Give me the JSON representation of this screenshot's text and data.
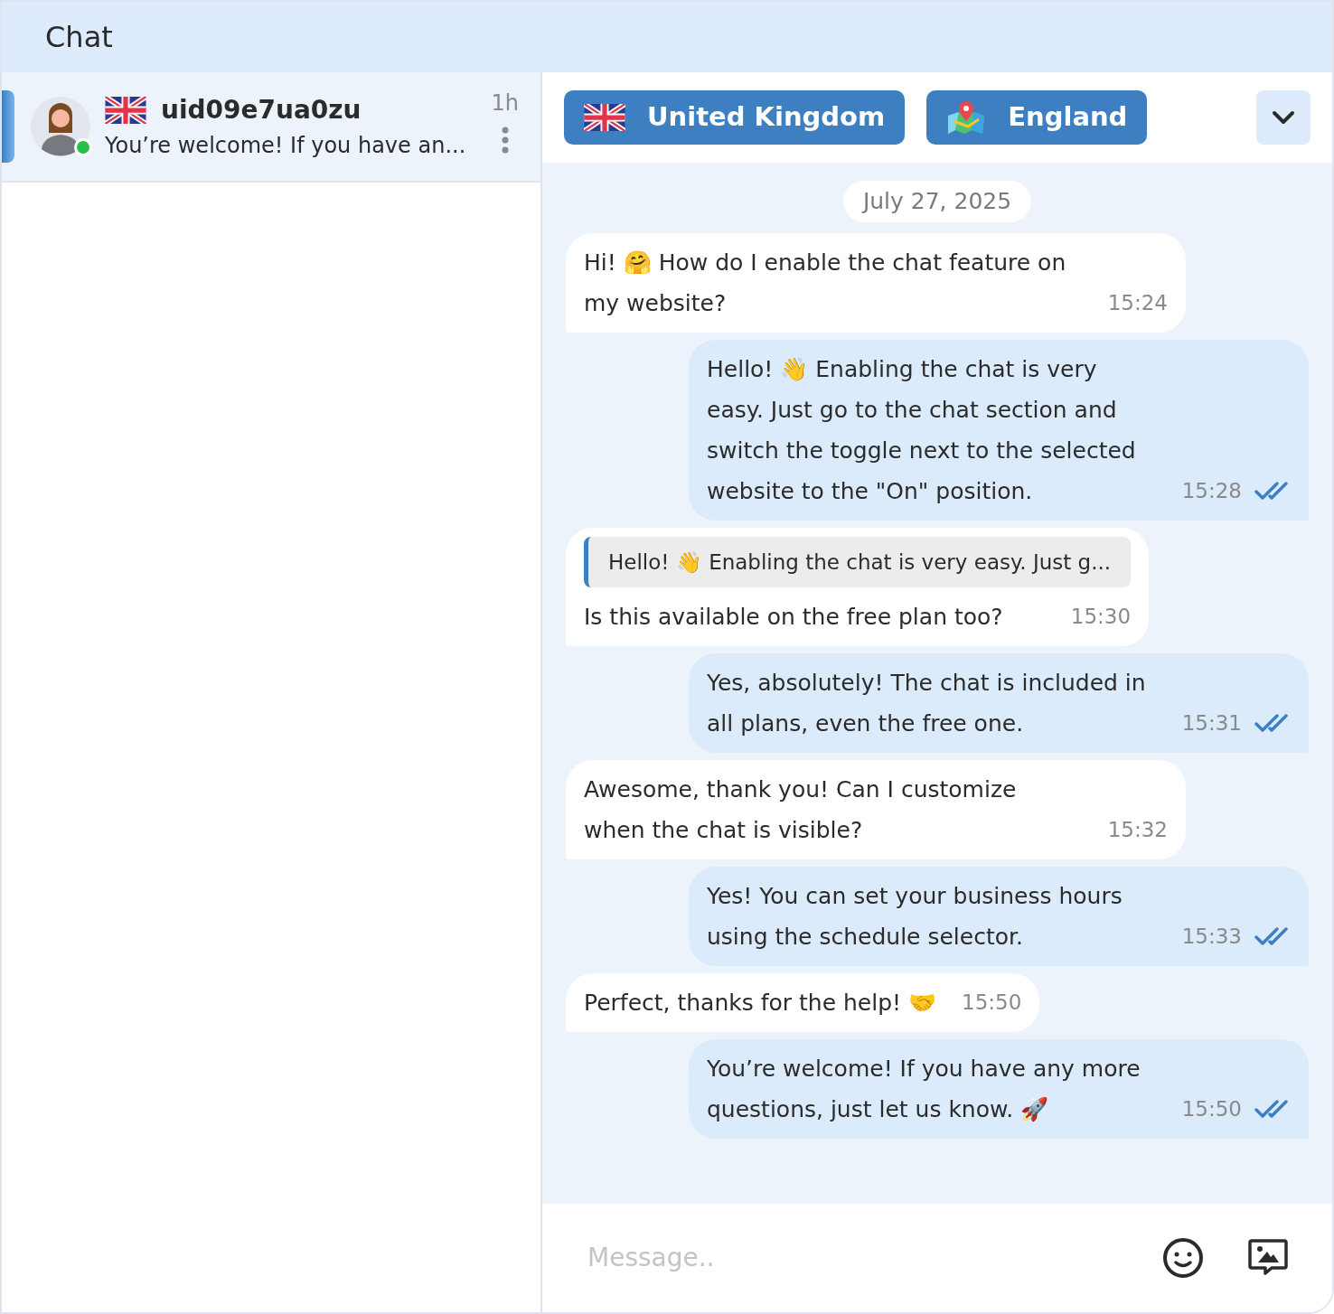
{
  "header": {
    "title": "Chat"
  },
  "conversations": [
    {
      "name": "uid09e7ua0zu",
      "preview": "You’re welcome! If you have an...",
      "time": "1h",
      "selected": true,
      "online": true
    }
  ],
  "chat_header": {
    "tags": [
      {
        "kind": "country",
        "label": "United Kingdom"
      },
      {
        "kind": "region",
        "label": "England"
      }
    ]
  },
  "date": "July 27, 2025",
  "messages": [
    {
      "kind": "received",
      "text": "Hi! 🤗 How do I enable the chat feature on my website?",
      "time": "15:24"
    },
    {
      "kind": "sent",
      "text": "Hello! 👋 Enabling the chat is very easy. Just go to the chat section and switch the toggle next to the selected website to the \"On\" position.",
      "time": "15:28",
      "read": true
    },
    {
      "kind": "received",
      "quote": "Hello! 👋 Enabling the chat is very easy. Just g...",
      "text": "Is this available on the free plan too?",
      "time": "15:30"
    },
    {
      "kind": "sent",
      "text": "Yes, absolutely! The chat is included in all plans, even the free one.",
      "time": "15:31",
      "read": true
    },
    {
      "kind": "received",
      "text": "Awesome, thank you! Can I customize when the chat is visible?",
      "time": "15:32"
    },
    {
      "kind": "sent",
      "text": "Yes! You can set your business hours using the schedule selector.",
      "time": "15:33",
      "read": true
    },
    {
      "kind": "received",
      "text": "Perfect, thanks for the help! 🤝",
      "time": "15:50"
    },
    {
      "kind": "sent",
      "text": "You’re welcome! If you have any more questions, just let us know. 🚀",
      "time": "15:50",
      "read": true
    }
  ],
  "composer": {
    "placeholder": "Message.."
  }
}
